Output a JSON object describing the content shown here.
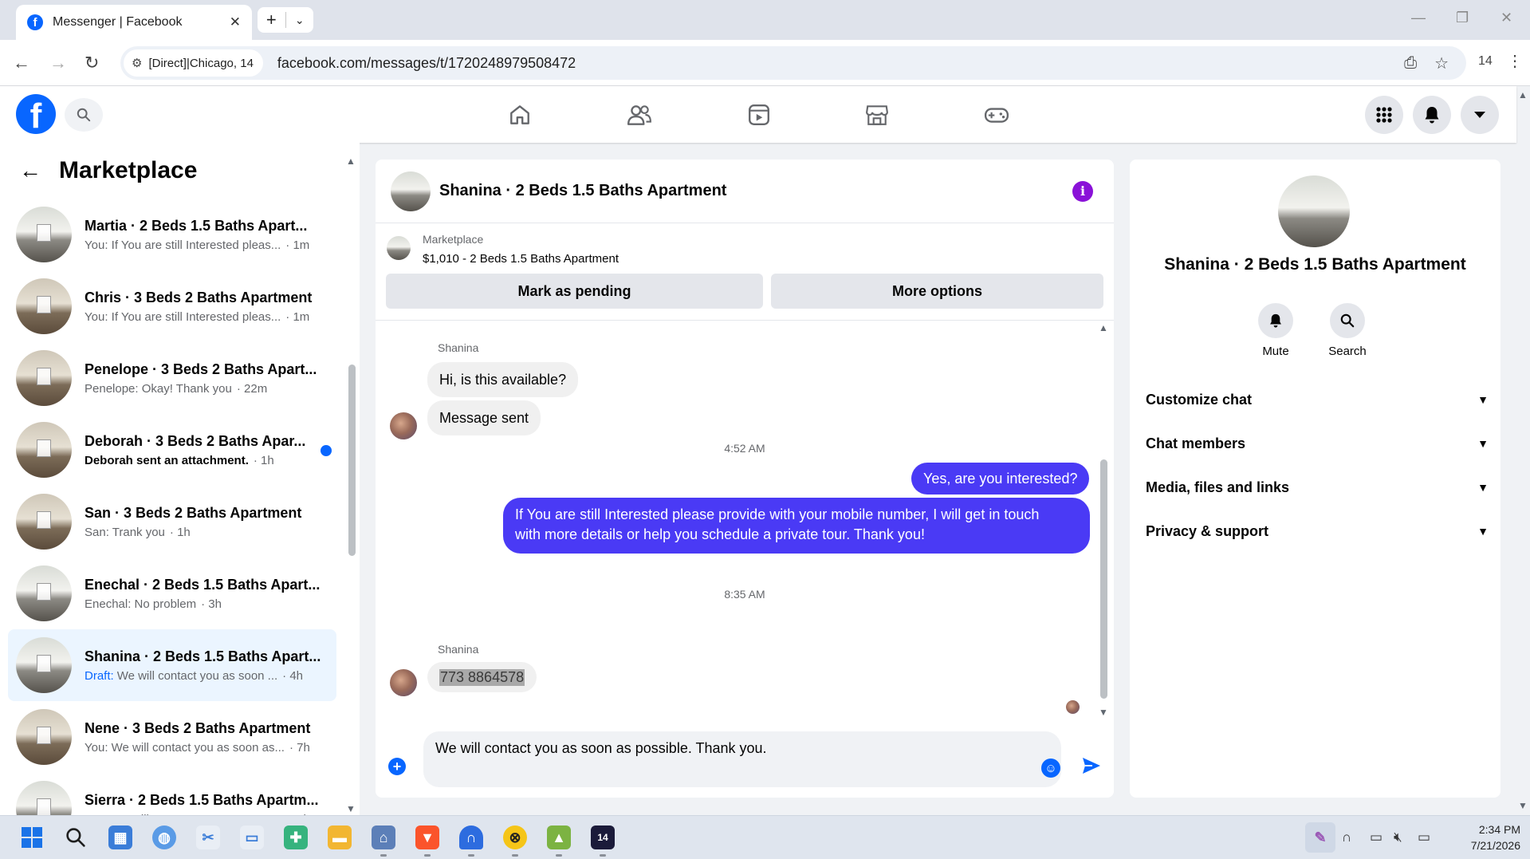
{
  "browser": {
    "tab_title": "Messenger | Facebook",
    "site_chip": "[Direct]|Chicago, 14",
    "url": "facebook.com/messages/t/1720248979508472",
    "extension_badge": "14"
  },
  "sidebar": {
    "title": "Marketplace",
    "conversations": [
      {
        "name": "Martia · 2 Beds 1.5 Baths Apart...",
        "preview": "You: If You are still Interested pleas...",
        "time": "1m",
        "photo": "bright"
      },
      {
        "name": "Chris · 3 Beds 2 Baths Apartment",
        "preview": "You: If You are still Interested pleas...",
        "time": "1m",
        "photo": "dark"
      },
      {
        "name": "Penelope · 3 Beds 2 Baths Apart...",
        "preview": "Penelope: Okay! Thank you",
        "time": "22m",
        "photo": "dark"
      },
      {
        "name": "Deborah · 3 Beds 2 Baths Apar...",
        "preview": "Deborah sent an attachment.",
        "time": "1h",
        "photo": "dark",
        "unread": true
      },
      {
        "name": "San · 3 Beds 2 Baths Apartment",
        "preview": "San: Trank you",
        "time": "1h",
        "photo": "dark"
      },
      {
        "name": "Enechal · 2 Beds 1.5 Baths Apart...",
        "preview": "Enechal: No problem",
        "time": "3h",
        "photo": "bright"
      },
      {
        "name": "Shanina · 2 Beds 1.5 Baths Apart...",
        "draft_label": "Draft:",
        "preview": "We will contact you as soon ...",
        "time": "4h",
        "photo": "bright",
        "active": true
      },
      {
        "name": "Nene · 3 Beds 2 Baths Apartment",
        "preview": "You: We will contact you as soon as...",
        "time": "7h",
        "photo": "dark"
      },
      {
        "name": "Sierra · 2 Beds 1.5 Baths Apartm...",
        "preview": "You: We will contact you as soon as...",
        "time": "7h",
        "photo": "bright"
      }
    ]
  },
  "chat": {
    "title": "Shanina · 2 Beds 1.5 Baths Apartment",
    "listing_source": "Marketplace",
    "listing_title": "$1,010 - 2 Beds 1.5 Baths Apartment",
    "mark_pending_label": "Mark as pending",
    "more_options_label": "More options",
    "sender_name": "Shanina",
    "msg_available": "Hi, is this available?",
    "msg_sent": "Message sent",
    "time_1": "4:52 AM",
    "msg_interested": "Yes, are you interested?",
    "msg_details_line1": "If You are still Interested please provide with your mobile number, I will get in touch",
    "msg_details_line2": "with more details or help you schedule a private tour. Thank you!",
    "time_2": "8:35 AM",
    "msg_phone": "773 8864578",
    "composer_value": "We will contact you as soon as possible. Thank you."
  },
  "details": {
    "title": "Shanina · 2 Beds 1.5 Baths Apartment",
    "mute_label": "Mute",
    "search_label": "Search",
    "sections": [
      "Customize chat",
      "Chat members",
      "Media, files and links",
      "Privacy & support"
    ]
  },
  "taskbar": {
    "time": "2:34 PM",
    "date": "7/21/2026",
    "badge": "14"
  },
  "colors": {
    "brand": "#0866ff",
    "outgoing_bubble": "#4a3af5",
    "info_icon": "#8a12d8"
  }
}
